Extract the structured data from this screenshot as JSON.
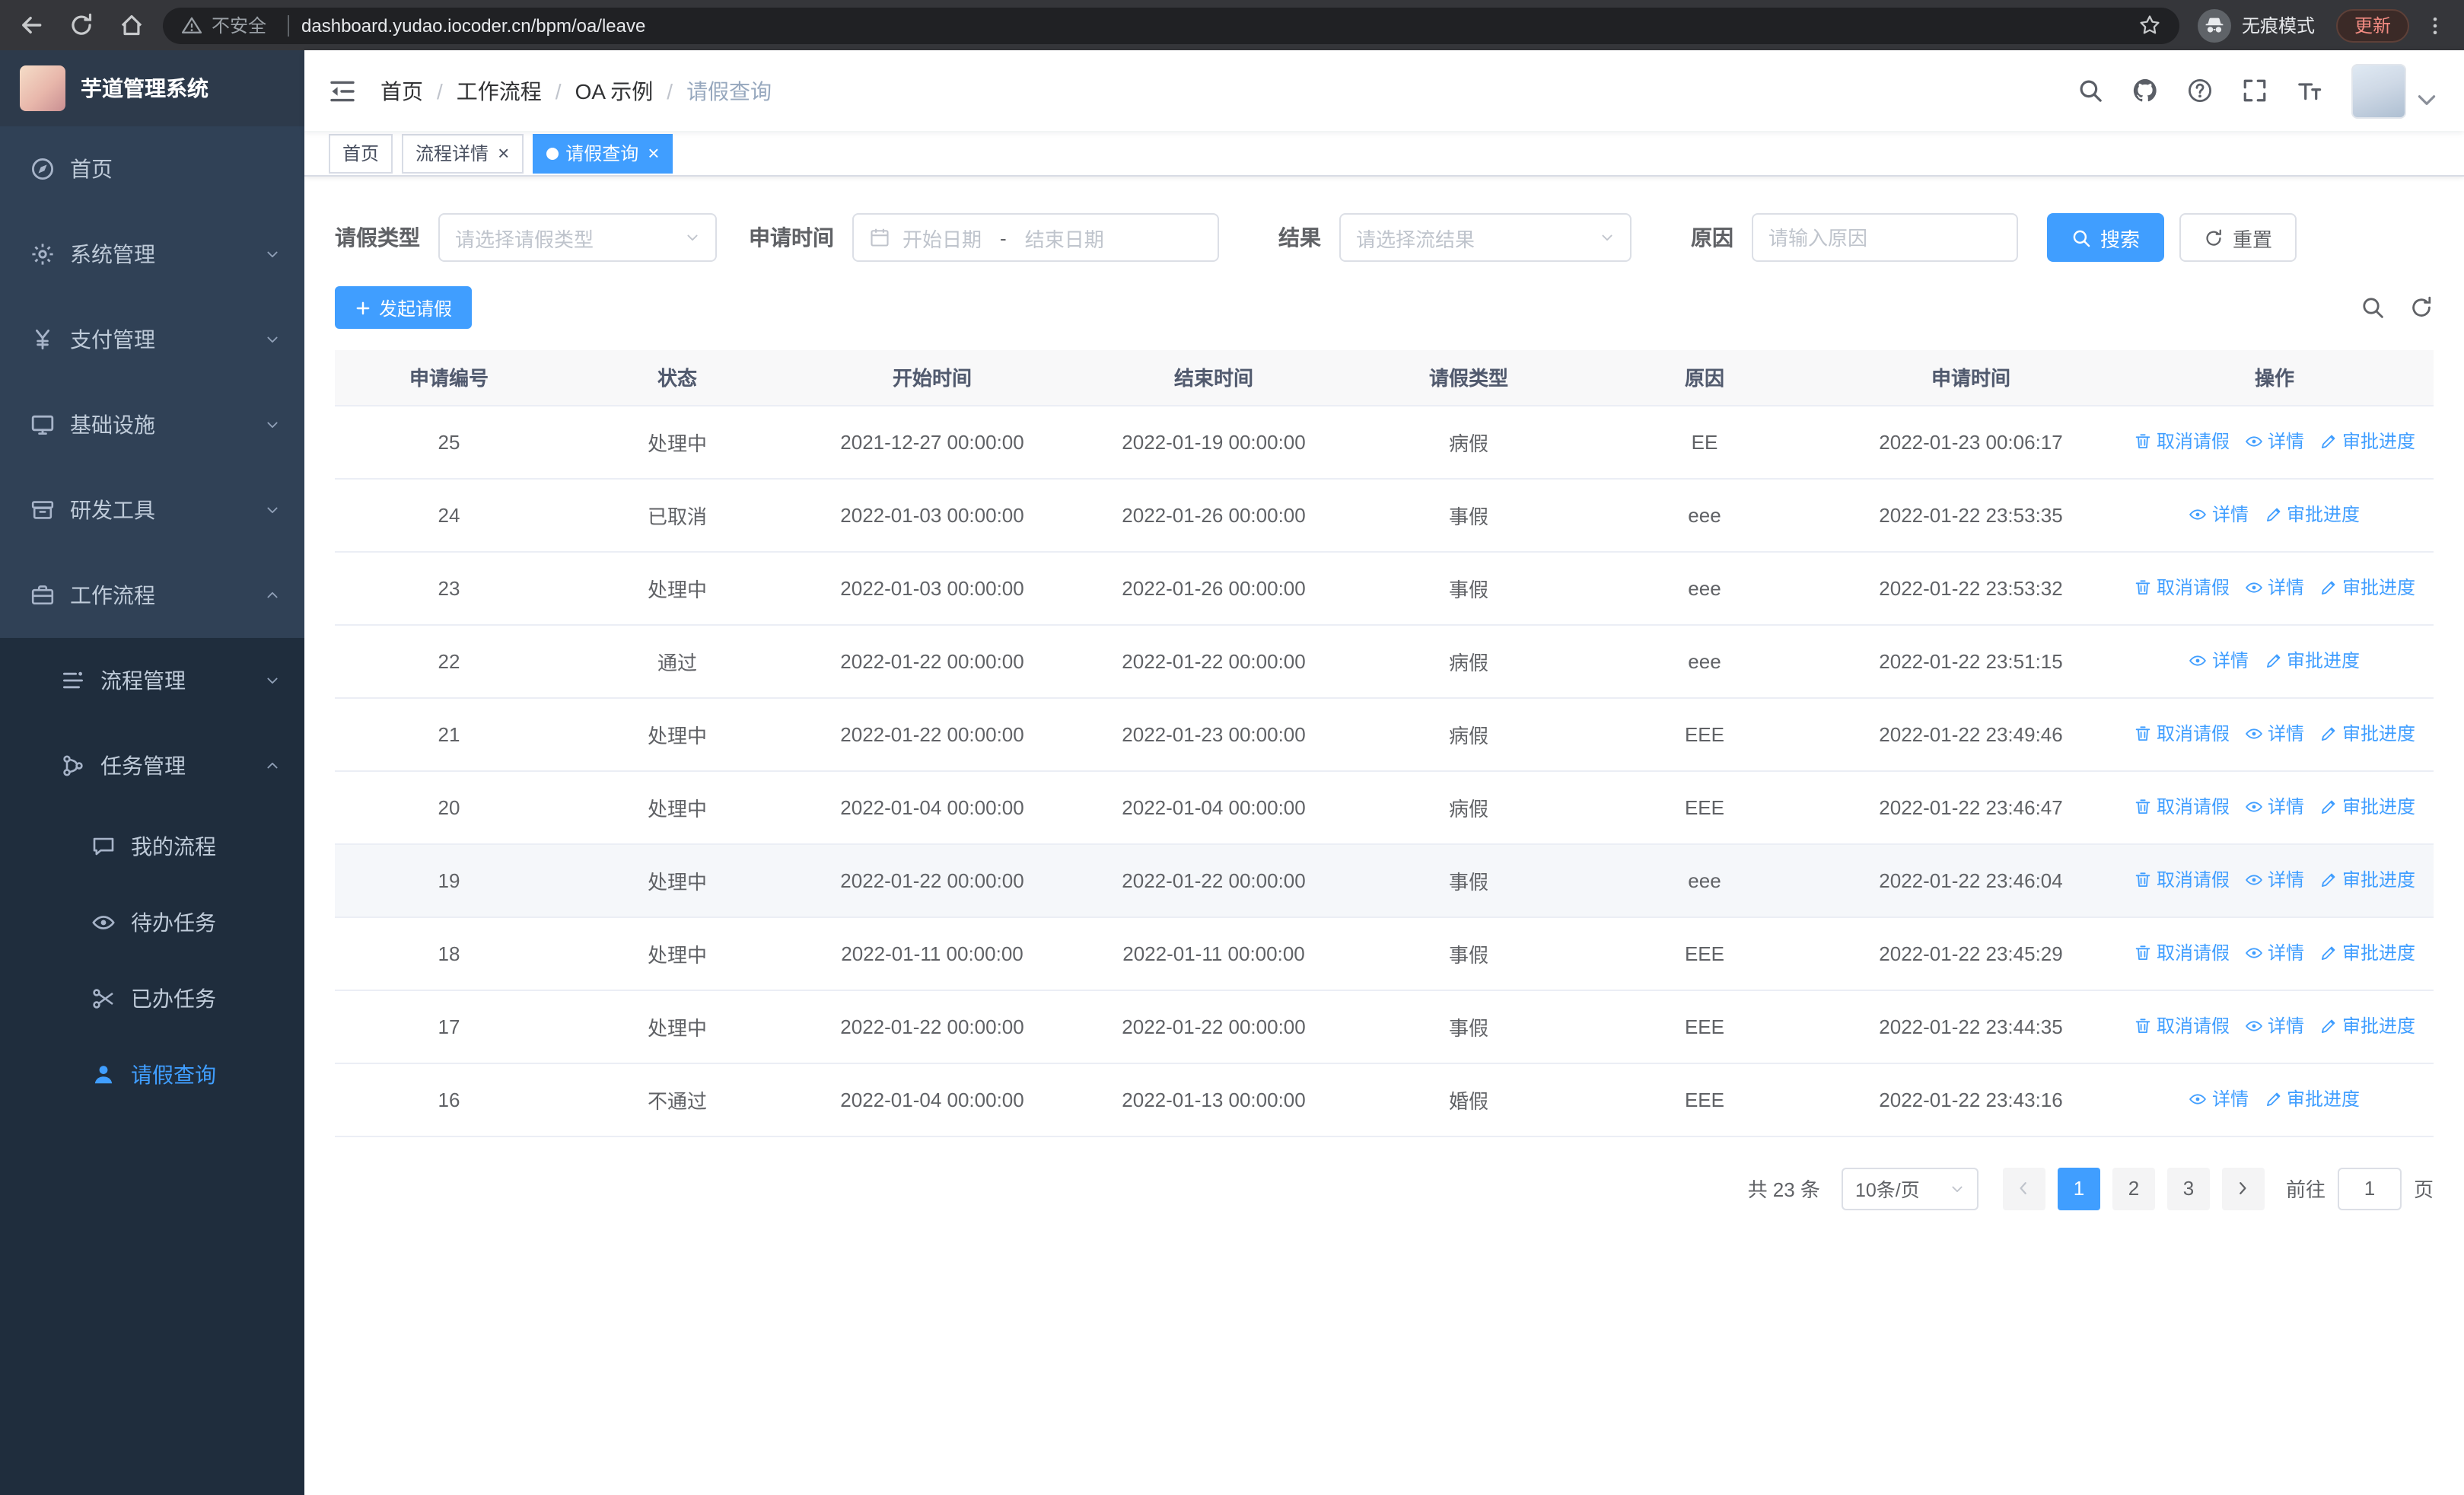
{
  "browser": {
    "security_label": "不安全",
    "url": "dashboard.yudao.iocoder.cn/bpm/oa/leave",
    "incognito_label": "无痕模式",
    "update_label": "更新"
  },
  "sidebar": {
    "logo_title": "芋道管理系统",
    "items": [
      {
        "name": "home",
        "label": "首页",
        "icon": "dashboard-icon",
        "level": 1
      },
      {
        "name": "system-management",
        "label": "系统管理",
        "icon": "gear-icon",
        "level": 1,
        "arrow": "down"
      },
      {
        "name": "payment-management",
        "label": "支付管理",
        "icon": "yen-icon",
        "level": 1,
        "arrow": "down"
      },
      {
        "name": "infrastructure",
        "label": "基础设施",
        "icon": "monitor-icon",
        "level": 1,
        "arrow": "down"
      },
      {
        "name": "dev-tools",
        "label": "研发工具",
        "icon": "toolbox-icon",
        "level": 1,
        "arrow": "down"
      },
      {
        "name": "workflow",
        "label": "工作流程",
        "icon": "briefcase-icon",
        "level": 1,
        "arrow": "up"
      },
      {
        "name": "process-management",
        "label": "流程管理",
        "icon": "process-icon",
        "level": 2,
        "arrow": "down"
      },
      {
        "name": "task-management",
        "label": "任务管理",
        "icon": "task-icon",
        "level": 2,
        "arrow": "up"
      },
      {
        "name": "my-process",
        "label": "我的流程",
        "icon": "chat-icon",
        "level": 3
      },
      {
        "name": "todo-tasks",
        "label": "待办任务",
        "icon": "eye-icon",
        "level": 3
      },
      {
        "name": "done-tasks",
        "label": "已办任务",
        "icon": "scissors-icon",
        "level": 3
      },
      {
        "name": "leave-query",
        "label": "请假查询",
        "icon": "user-icon",
        "level": 3,
        "active": true
      }
    ]
  },
  "header": {
    "breadcrumb": [
      "首页",
      "工作流程",
      "OA 示例",
      "请假查询"
    ]
  },
  "tabs": [
    {
      "name": "home",
      "label": "首页",
      "closable": false,
      "active": false
    },
    {
      "name": "process-detail",
      "label": "流程详情",
      "closable": true,
      "active": false
    },
    {
      "name": "leave-query",
      "label": "请假查询",
      "closable": true,
      "active": true
    }
  ],
  "filters": {
    "leave_type": {
      "label": "请假类型",
      "placeholder": "请选择请假类型"
    },
    "apply_time": {
      "label": "申请时间",
      "start_placeholder": "开始日期",
      "separator": "-",
      "end_placeholder": "结束日期"
    },
    "result": {
      "label": "结果",
      "placeholder": "请选择流结果"
    },
    "reason": {
      "label": "原因",
      "placeholder": "请输入原因"
    },
    "search_label": "搜索",
    "reset_label": "重置"
  },
  "toolbar": {
    "create_label": "发起请假"
  },
  "table": {
    "columns": [
      "申请编号",
      "状态",
      "开始时间",
      "结束时间",
      "请假类型",
      "原因",
      "申请时间",
      "操作"
    ],
    "action_labels": {
      "cancel": "取消请假",
      "detail": "详情",
      "progress": "审批进度"
    },
    "rows": [
      {
        "id": "25",
        "status": "处理中",
        "start": "2021-12-27 00:00:00",
        "end": "2022-01-19 00:00:00",
        "type": "病假",
        "reason": "EE",
        "applied": "2022-01-23 00:06:17",
        "actions": [
          "cancel",
          "detail",
          "progress"
        ]
      },
      {
        "id": "24",
        "status": "已取消",
        "start": "2022-01-03 00:00:00",
        "end": "2022-01-26 00:00:00",
        "type": "事假",
        "reason": "eee",
        "applied": "2022-01-22 23:53:35",
        "actions": [
          "detail",
          "progress"
        ]
      },
      {
        "id": "23",
        "status": "处理中",
        "start": "2022-01-03 00:00:00",
        "end": "2022-01-26 00:00:00",
        "type": "事假",
        "reason": "eee",
        "applied": "2022-01-22 23:53:32",
        "actions": [
          "cancel",
          "detail",
          "progress"
        ]
      },
      {
        "id": "22",
        "status": "通过",
        "start": "2022-01-22 00:00:00",
        "end": "2022-01-22 00:00:00",
        "type": "病假",
        "reason": "eee",
        "applied": "2022-01-22 23:51:15",
        "actions": [
          "detail",
          "progress"
        ]
      },
      {
        "id": "21",
        "status": "处理中",
        "start": "2022-01-22 00:00:00",
        "end": "2022-01-23 00:00:00",
        "type": "病假",
        "reason": "EEE",
        "applied": "2022-01-22 23:49:46",
        "actions": [
          "cancel",
          "detail",
          "progress"
        ]
      },
      {
        "id": "20",
        "status": "处理中",
        "start": "2022-01-04 00:00:00",
        "end": "2022-01-04 00:00:00",
        "type": "病假",
        "reason": "EEE",
        "applied": "2022-01-22 23:46:47",
        "actions": [
          "cancel",
          "detail",
          "progress"
        ]
      },
      {
        "id": "19",
        "status": "处理中",
        "start": "2022-01-22 00:00:00",
        "end": "2022-01-22 00:00:00",
        "type": "事假",
        "reason": "eee",
        "applied": "2022-01-22 23:46:04",
        "actions": [
          "cancel",
          "detail",
          "progress"
        ],
        "hover": true
      },
      {
        "id": "18",
        "status": "处理中",
        "start": "2022-01-11 00:00:00",
        "end": "2022-01-11 00:00:00",
        "type": "事假",
        "reason": "EEE",
        "applied": "2022-01-22 23:45:29",
        "actions": [
          "cancel",
          "detail",
          "progress"
        ]
      },
      {
        "id": "17",
        "status": "处理中",
        "start": "2022-01-22 00:00:00",
        "end": "2022-01-22 00:00:00",
        "type": "事假",
        "reason": "EEE",
        "applied": "2022-01-22 23:44:35",
        "actions": [
          "cancel",
          "detail",
          "progress"
        ]
      },
      {
        "id": "16",
        "status": "不通过",
        "start": "2022-01-04 00:00:00",
        "end": "2022-01-13 00:00:00",
        "type": "婚假",
        "reason": "EEE",
        "applied": "2022-01-22 23:43:16",
        "actions": [
          "detail",
          "progress"
        ]
      }
    ]
  },
  "pagination": {
    "total_label": "共 23 条",
    "page_size_label": "10条/页",
    "pages": [
      "1",
      "2",
      "3"
    ],
    "active_page": "1",
    "goto_label": "前往",
    "goto_value": "1",
    "page_unit_label": "页"
  },
  "colors": {
    "accent": "#409eff",
    "sidebar_bg": "#304156",
    "submenu_bg": "#1f2d3d",
    "table_header_bg": "#f8f8f9",
    "browser_bar_bg": "#35363a",
    "omnibox_bg": "#202124",
    "update_text": "#f28b82"
  }
}
